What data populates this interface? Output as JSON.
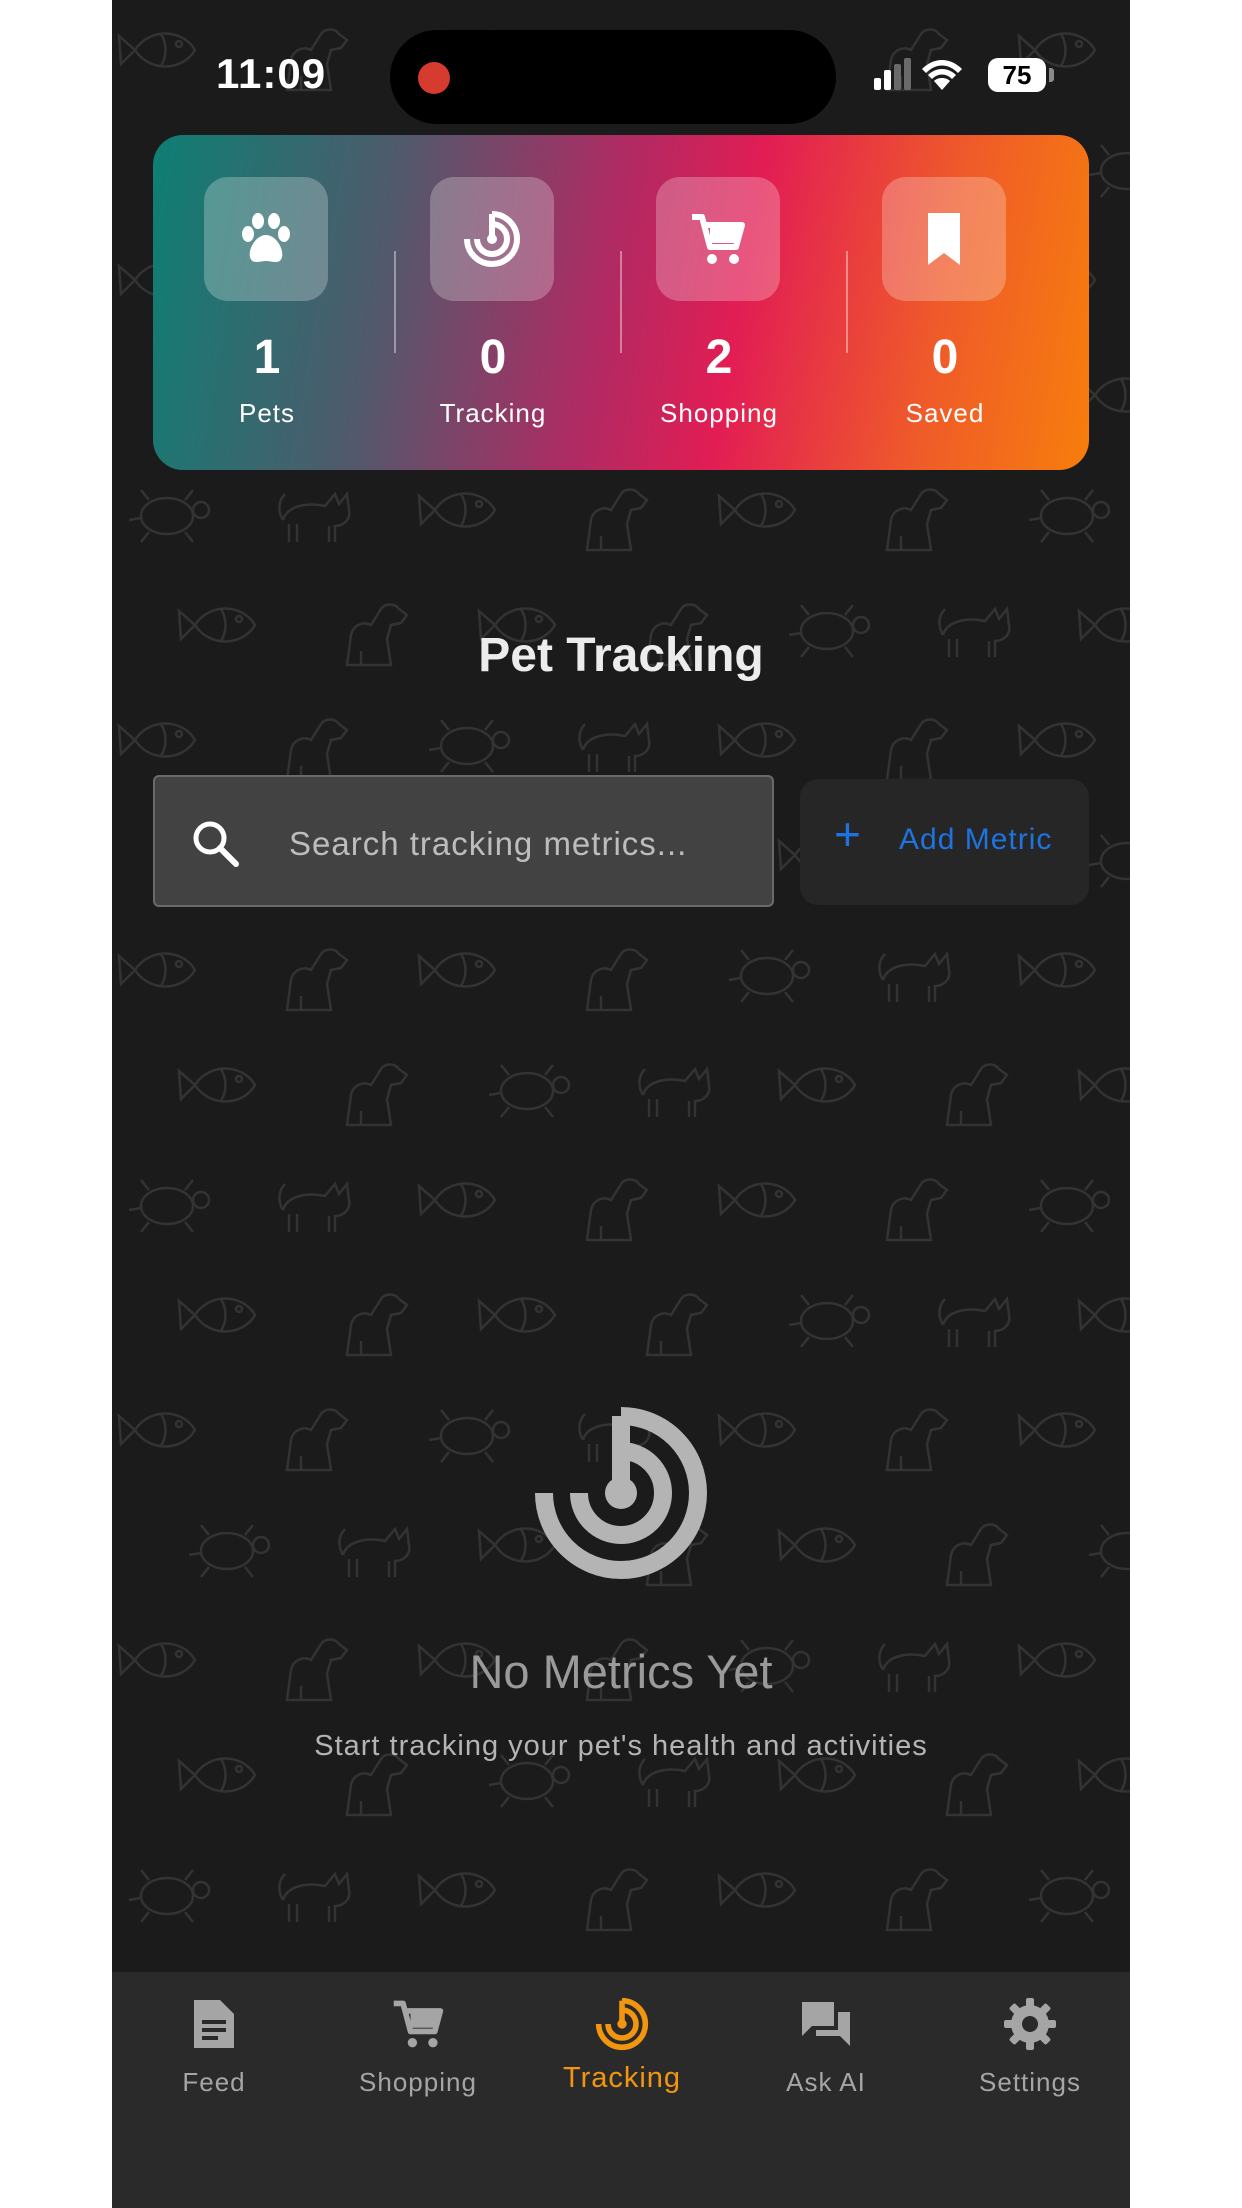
{
  "status_bar": {
    "time": "11:09",
    "battery": "75"
  },
  "stats": [
    {
      "icon": "paw-icon",
      "value": "1",
      "label": "Pets"
    },
    {
      "icon": "tracking-icon",
      "value": "0",
      "label": "Tracking"
    },
    {
      "icon": "cart-icon",
      "value": "2",
      "label": "Shopping"
    },
    {
      "icon": "bookmark-icon",
      "value": "0",
      "label": "Saved"
    }
  ],
  "page": {
    "title": "Pet Tracking",
    "search_placeholder": "Search tracking metrics...",
    "add_label": "Add Metric",
    "add_icon": "+"
  },
  "empty_state": {
    "icon": "tracking-icon",
    "title": "No Metrics Yet",
    "subtitle": "Start tracking your pet's health and activities"
  },
  "nav": {
    "items": [
      {
        "label": "Feed",
        "icon": "feed-icon"
      },
      {
        "label": "Shopping",
        "icon": "cart-icon"
      },
      {
        "label": "Tracking",
        "icon": "tracking-icon",
        "active": true
      },
      {
        "label": "Ask AI",
        "icon": "chat-icon"
      },
      {
        "label": "Settings",
        "icon": "gear-icon"
      }
    ]
  },
  "colors": {
    "background": "#1b1b1b",
    "accent_active": "#f2950f",
    "link_blue": "#1e73e0",
    "gradient": [
      "#0d7f74",
      "#e21d54",
      "#f77e0c"
    ]
  }
}
